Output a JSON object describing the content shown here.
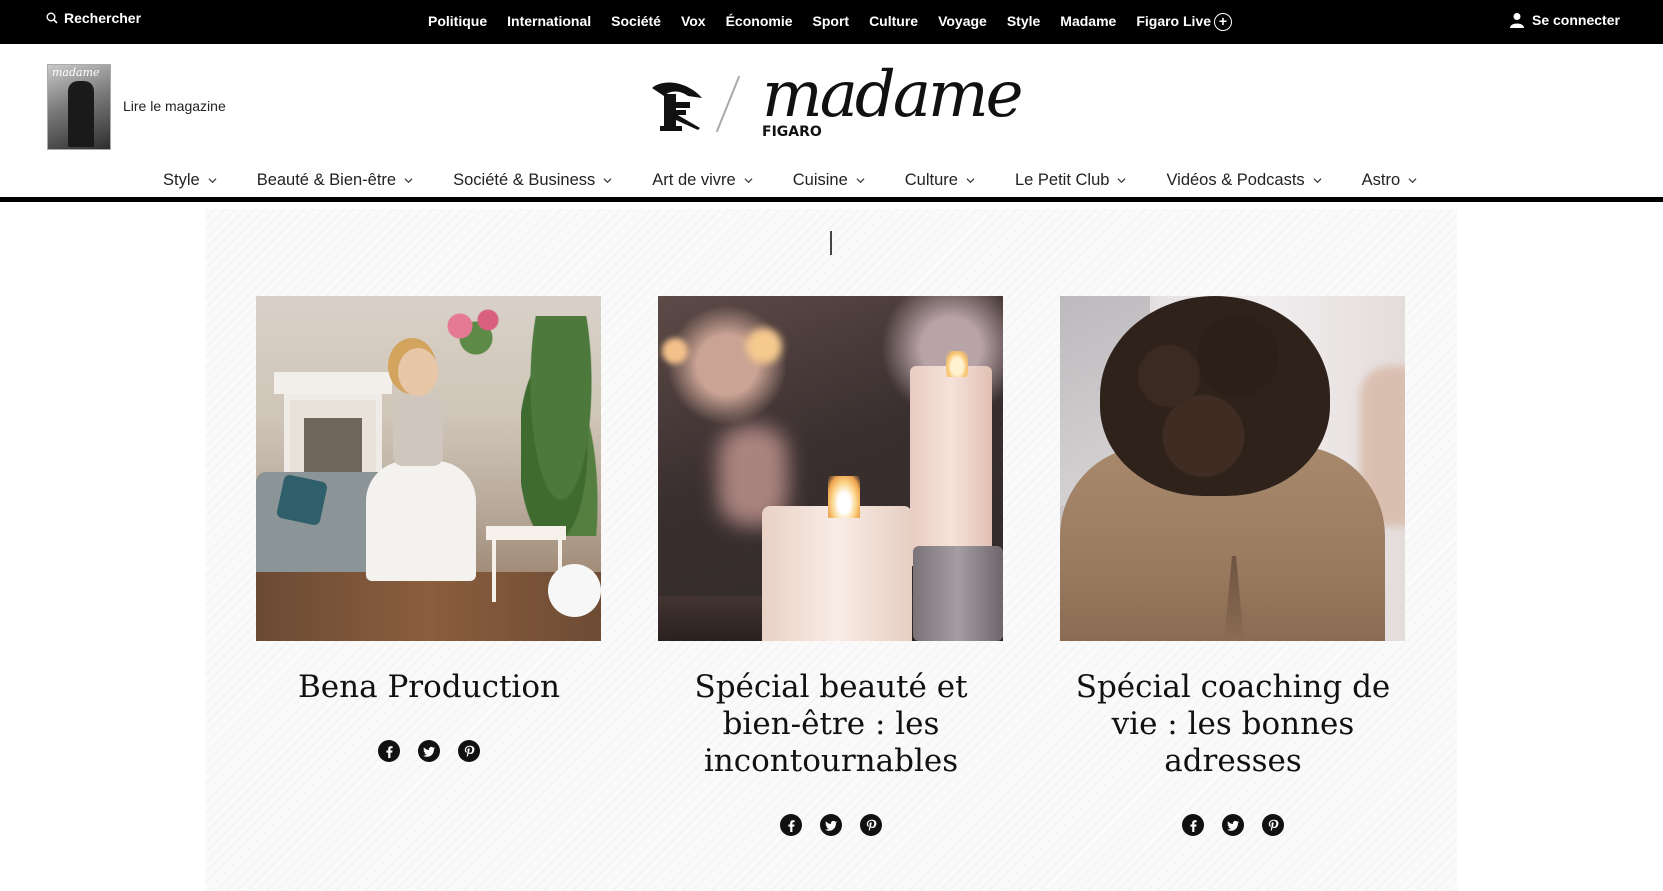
{
  "topbar": {
    "search_label": "Rechercher",
    "nav": [
      "Politique",
      "International",
      "Société",
      "Vox",
      "Économie",
      "Sport",
      "Culture",
      "Voyage",
      "Style",
      "Madame",
      "Figaro Live"
    ],
    "login_label": "Se connecter"
  },
  "header": {
    "magazine_link": "Lire le magazine",
    "magazine_cover_title": "madame",
    "logo_main": "madame",
    "logo_sub": "FIGARO"
  },
  "catnav": [
    "Style",
    "Beauté & Bien-être",
    "Société & Business",
    "Art de vivre",
    "Cuisine",
    "Culture",
    "Le Petit Club",
    "Vidéos & Podcasts",
    "Astro"
  ],
  "cards": [
    {
      "title": "Bena Production"
    },
    {
      "title": "Spécial beauté et bien-être : les incontournables"
    },
    {
      "title": "Spécial coaching de vie : les bonnes adresses"
    }
  ],
  "icons": {
    "search": "search-icon",
    "add": "plus-circle-icon",
    "user": "user-icon",
    "chevron": "chevron-down-icon",
    "facebook": "facebook-icon",
    "twitter": "twitter-icon",
    "pinterest": "pinterest-icon"
  }
}
